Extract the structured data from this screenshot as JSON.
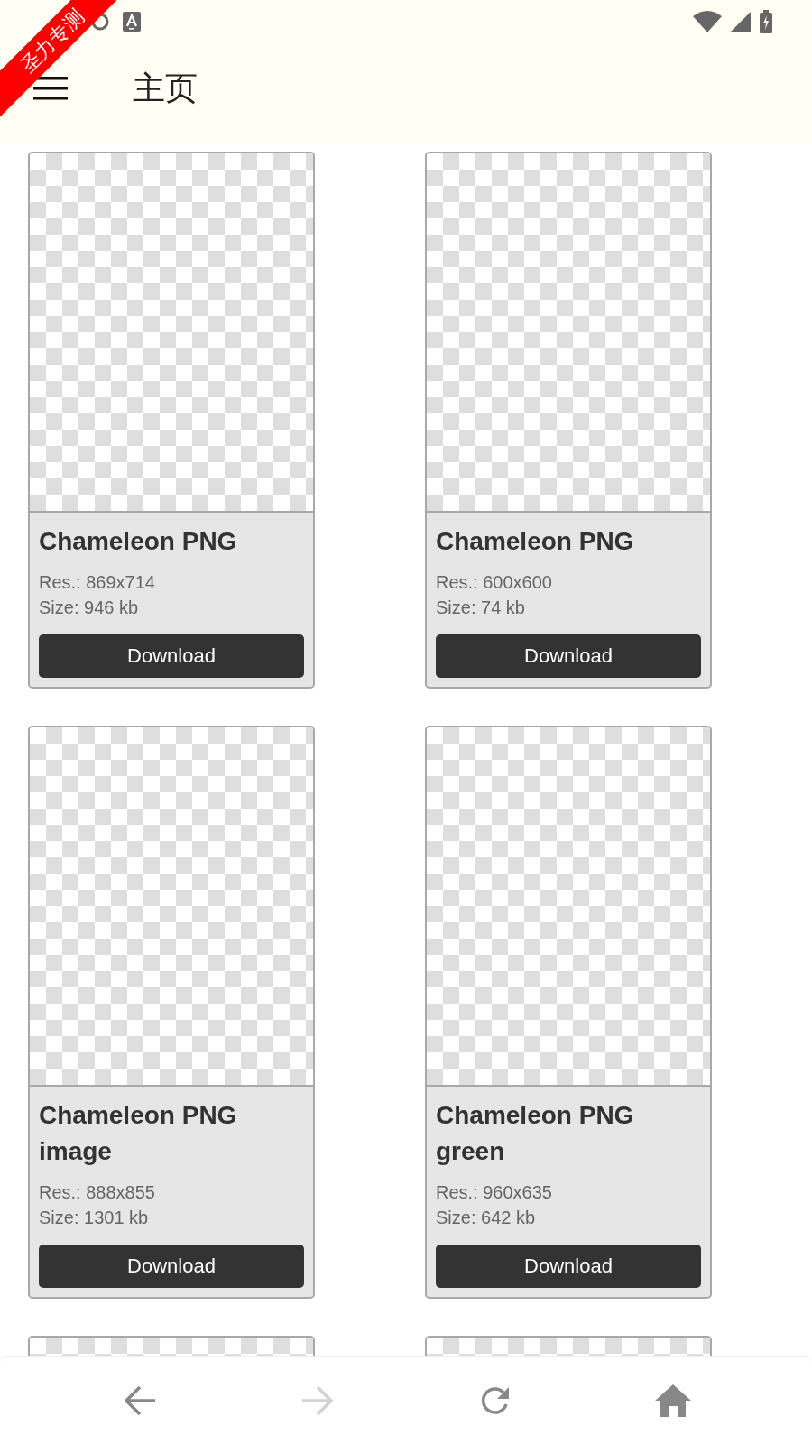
{
  "debug_banner": "圣力专测",
  "app_bar": {
    "title": "主页"
  },
  "cards": [
    {
      "title": "Chameleon PNG",
      "resolution": "Res.: 869x714",
      "size": "Size: 946 kb",
      "button": "Download"
    },
    {
      "title": "Chameleon PNG",
      "resolution": "Res.: 600x600",
      "size": "Size: 74 kb",
      "button": "Download"
    },
    {
      "title": "Chameleon PNG image",
      "resolution": "Res.: 888x855",
      "size": "Size: 1301 kb",
      "button": "Download"
    },
    {
      "title": "Chameleon PNG green",
      "resolution": "Res.: 960x635",
      "size": "Size: 642 kb",
      "button": "Download"
    }
  ],
  "nav": [
    {
      "kind": "back",
      "disabled": false
    },
    {
      "kind": "forward",
      "disabled": true
    },
    {
      "kind": "reload",
      "disabled": false
    },
    {
      "kind": "home",
      "disabled": false
    }
  ]
}
